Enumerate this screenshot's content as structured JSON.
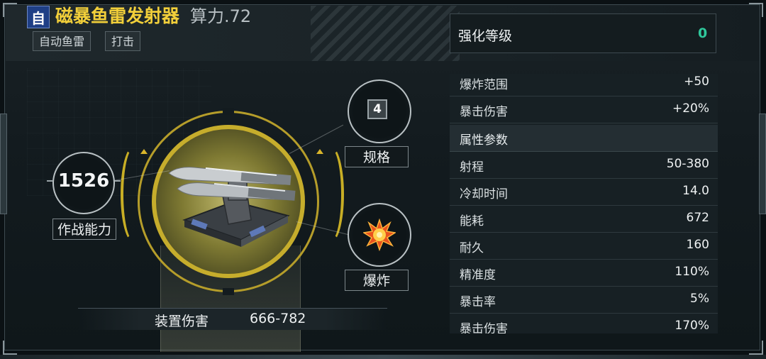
{
  "header": {
    "auto_tag": "自",
    "weapon_name": "磁暴鱼雷发射器",
    "power": "算力.72",
    "tags": [
      "自动鱼雷",
      "打击"
    ]
  },
  "left": {
    "combat_value": "1526",
    "combat_label": "作战能力",
    "spec_value": "4",
    "spec_label": "规格",
    "explode_label": "爆炸",
    "explode_icon": "explosion-icon",
    "damage_label": "装置伤害",
    "damage_value": "666-782"
  },
  "enhance": {
    "label": "强化等级",
    "value": "0"
  },
  "top_rows": [
    {
      "name": "爆炸范围",
      "value": "+50"
    },
    {
      "name": "暴击伤害",
      "value": "+20%"
    }
  ],
  "attr_section": "属性参数",
  "attr_rows": [
    {
      "name": "射程",
      "value": "50-380"
    },
    {
      "name": "冷却时间",
      "value": "14.0"
    },
    {
      "name": "能耗",
      "value": "672"
    },
    {
      "name": "耐久",
      "value": "160"
    },
    {
      "name": "精准度",
      "value": "110%"
    },
    {
      "name": "暴击率",
      "value": "5%"
    },
    {
      "name": "暴击伤害",
      "value": "170%"
    }
  ],
  "colors": {
    "accent_gold": "#c6ad2c",
    "name_yellow": "#f2cf3a",
    "level_green": "#2fc79b",
    "tag_blue": "#1f3f86"
  }
}
